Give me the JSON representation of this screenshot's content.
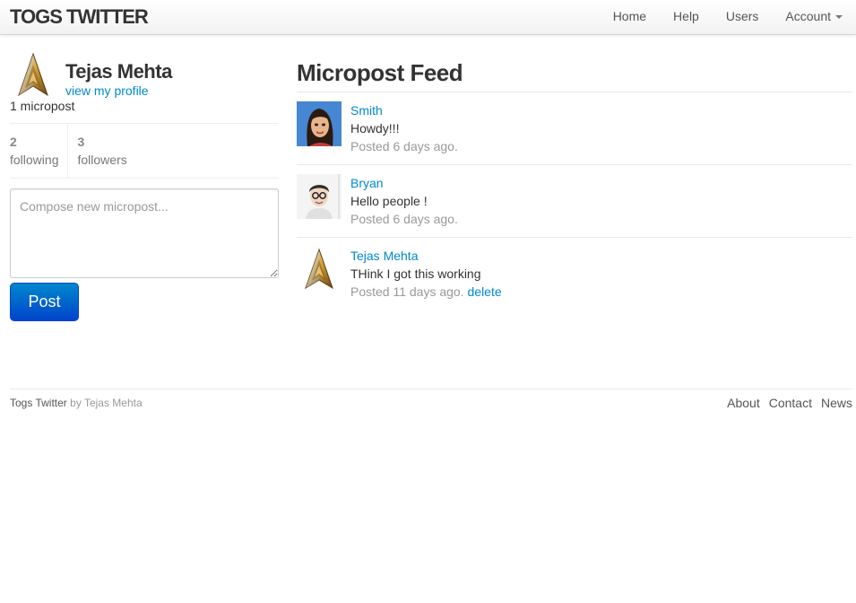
{
  "header": {
    "brand": "TOGS TWITTER",
    "nav": {
      "home": "Home",
      "help": "Help",
      "users": "Users",
      "account": "Account"
    }
  },
  "sidebar": {
    "user_name": "Tejas Mehta",
    "view_profile": "view my profile",
    "micropost_count": "1 micropost",
    "following_count": "2",
    "following_label": "following",
    "followers_count": "3",
    "followers_label": "followers",
    "compose_placeholder": "Compose new micropost...",
    "post_button": "Post"
  },
  "feed": {
    "title": "Micropost Feed",
    "items": [
      {
        "user": "Smith",
        "content": "Howdy!!!",
        "timestamp": "Posted 6 days ago.",
        "avatar": "cartoon-woman-avatar"
      },
      {
        "user": "Bryan",
        "content": "Hello people !",
        "timestamp": "Posted 6 days ago.",
        "avatar": "man-with-glasses-avatar"
      },
      {
        "user": "Tejas Mehta",
        "content": "THink I got this working",
        "timestamp": "Posted 11 days ago.",
        "delete": "delete",
        "avatar": "gold-star-insignia-avatar"
      }
    ]
  },
  "footer": {
    "site_name": "Togs Twitter",
    "by_text": "by Tejas Mehta",
    "links": {
      "about": "About",
      "contact": "Contact",
      "news": "News"
    }
  },
  "colors": {
    "link": "#0088cc",
    "button": "#0055cc",
    "muted": "#999999"
  }
}
